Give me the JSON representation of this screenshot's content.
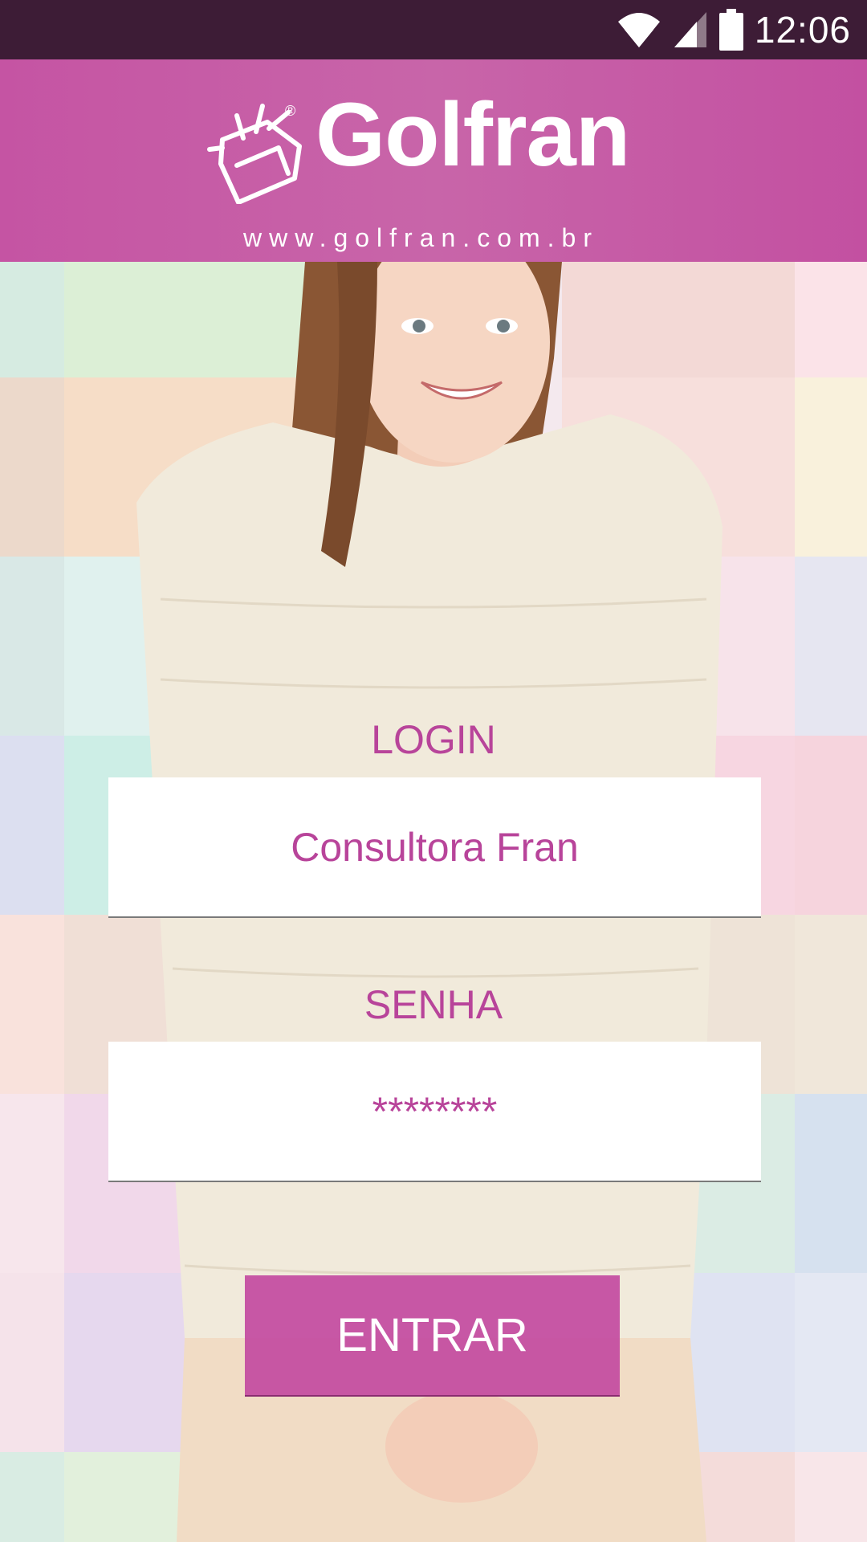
{
  "status_bar": {
    "time": "12:06",
    "icons": [
      "wifi-icon",
      "cell-signal-icon",
      "battery-icon"
    ]
  },
  "header": {
    "brand_name": "Golfran",
    "registered_mark": "®",
    "website": "www.golfran.com.br",
    "logo_icon": "gift-box-logo-icon"
  },
  "login": {
    "label": "LOGIN",
    "value": "Consultora Fran"
  },
  "password": {
    "label": "SENHA",
    "value": "********"
  },
  "submit": {
    "label": "ENTRAR"
  },
  "colors": {
    "accent": "#c554a3",
    "status_bar": "#3d1c36",
    "label_text": "#b8449a"
  }
}
